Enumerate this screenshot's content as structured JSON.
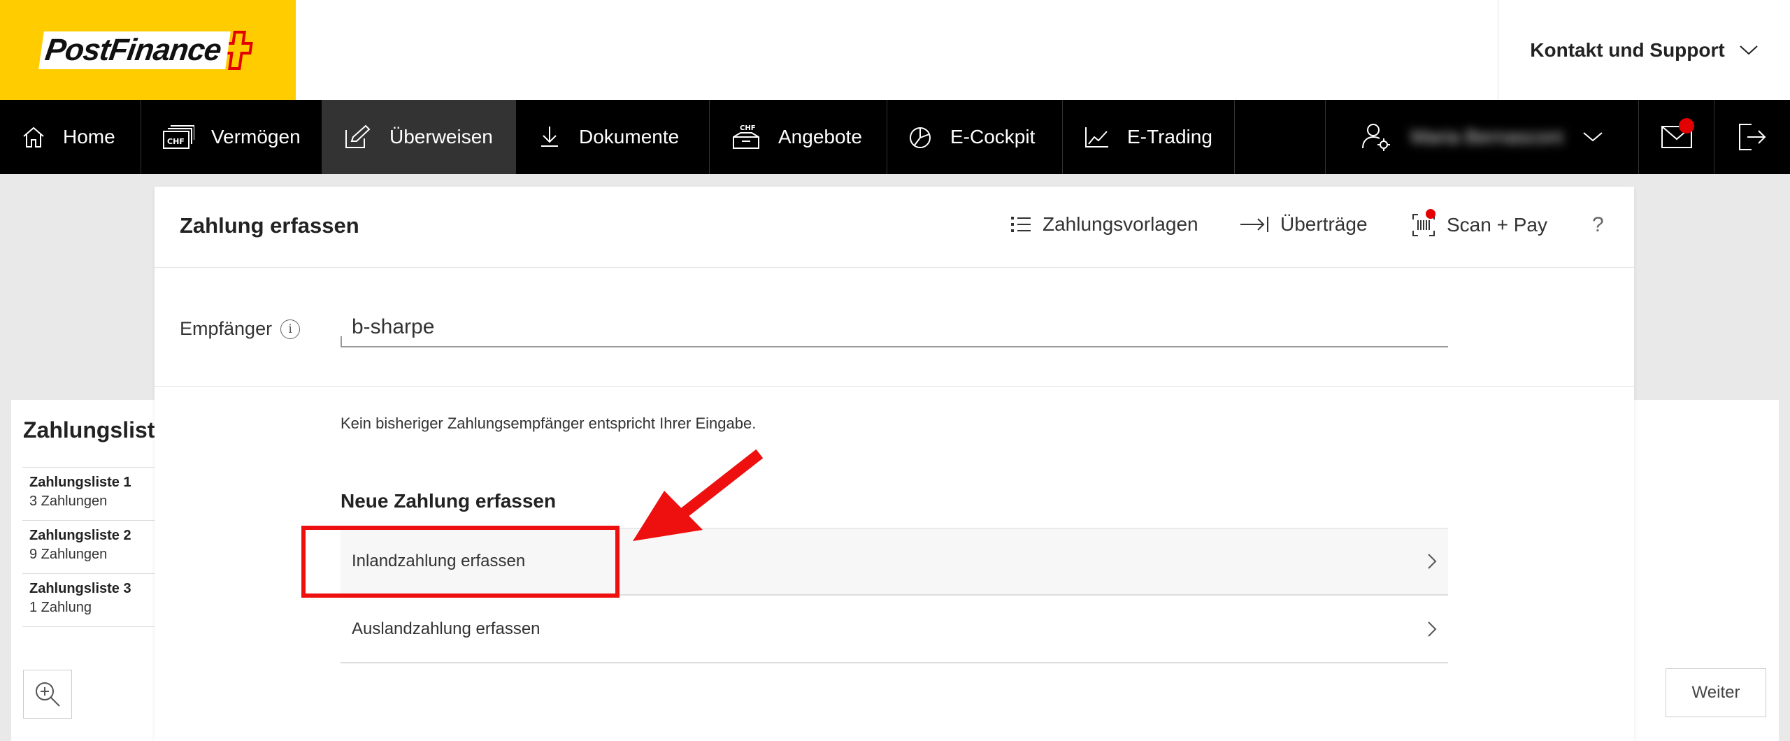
{
  "header": {
    "logo_text": "PostFinance",
    "support_label": "Kontakt und Support"
  },
  "nav": {
    "items": [
      {
        "label": "Home",
        "icon": "home-icon"
      },
      {
        "label": "Vermögen",
        "icon": "chf-wallet-icon"
      },
      {
        "label": "Überweisen",
        "icon": "pen-edit-icon",
        "active": true
      },
      {
        "label": "Dokumente",
        "icon": "download-tray-icon"
      },
      {
        "label": "Angebote",
        "icon": "chf-box-icon"
      },
      {
        "label": "E-Cockpit",
        "icon": "pie-chart-icon"
      },
      {
        "label": "E-Trading",
        "icon": "line-chart-icon"
      }
    ],
    "user_name": "Maria Bernasconi",
    "mail_has_notification": true
  },
  "background": {
    "zahlungsliste_title": "Zahlungsliste",
    "lists": [
      {
        "title": "Zahlungsliste 1",
        "count": "3 Zahlungen"
      },
      {
        "title": "Zahlungsliste 2",
        "count": "9 Zahlungen"
      },
      {
        "title": "Zahlungsliste 3",
        "count": "1 Zahlung"
      }
    ],
    "weiter_label": "Weiter"
  },
  "modal": {
    "title": "Zahlung erfassen",
    "actions": {
      "templates": "Zahlungsvorlagen",
      "transfers": "Überträge",
      "scan_pay": "Scan + Pay",
      "help": "?"
    },
    "recipient_label": "Empfänger",
    "recipient_value": "b-sharpe",
    "info_glyph": "i",
    "no_match_text": "Kein bisheriger Zahlungsempfänger entspricht Ihrer Eingabe.",
    "section_title": "Neue Zahlung erfassen",
    "options": [
      {
        "label": "Inlandzahlung erfassen"
      },
      {
        "label": "Auslandzahlung erfassen"
      }
    ]
  },
  "colors": {
    "brand_yellow": "#ffcc00",
    "nav_bg": "#000000",
    "nav_active": "#333333",
    "notification_red": "#e30000",
    "annotation_red": "#ee0f0f"
  }
}
